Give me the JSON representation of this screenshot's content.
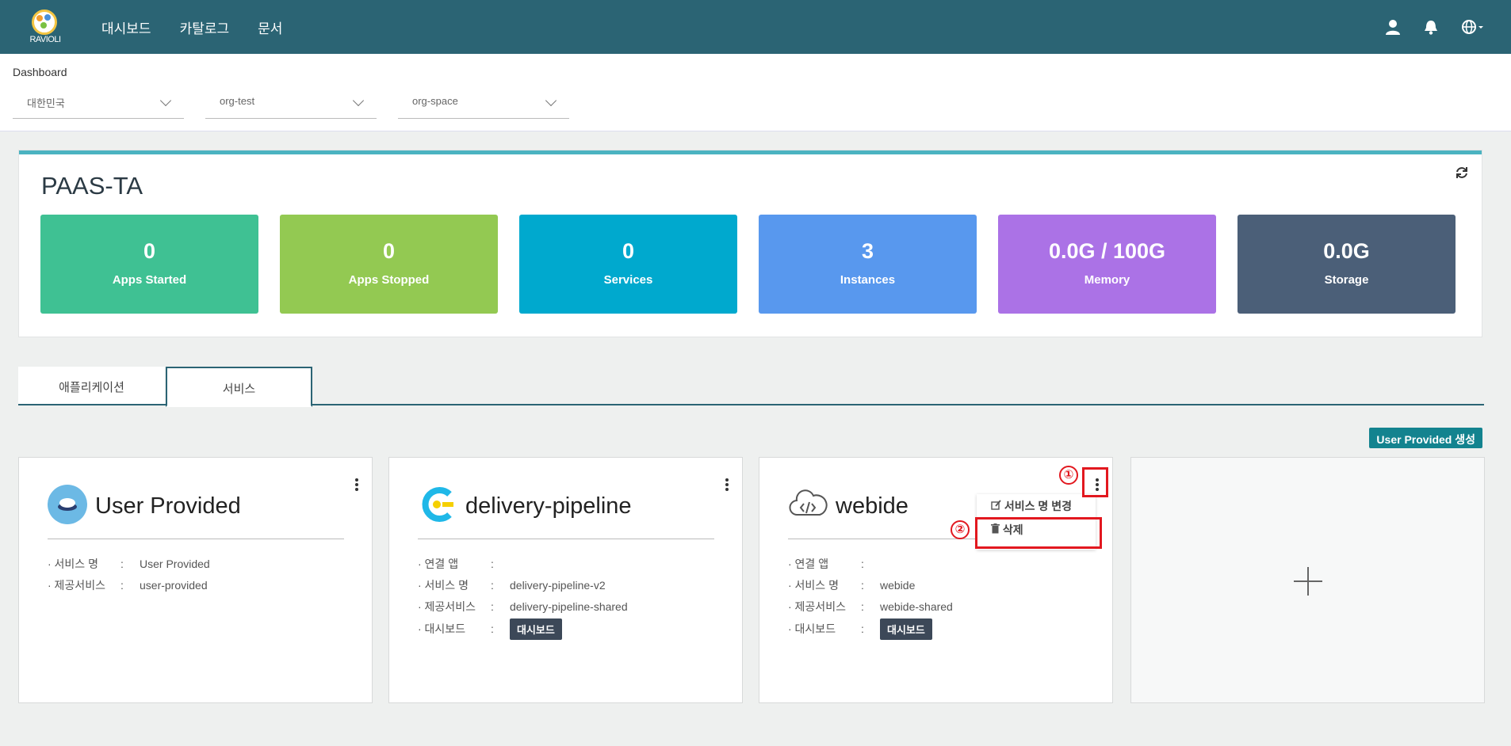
{
  "nav": {
    "logo_text": "RAVIOLI",
    "links": [
      "대시보드",
      "카탈로그",
      "문서"
    ]
  },
  "header": {
    "breadcrumb": "Dashboard",
    "selects": [
      "대한민국",
      "org-test",
      "org-space"
    ]
  },
  "panel": {
    "title": "PAAS-TA",
    "stats": [
      {
        "value": "0",
        "label": "Apps Started",
        "color": "#3fc193"
      },
      {
        "value": "0",
        "label": "Apps Stopped",
        "color": "#93c952"
      },
      {
        "value": "0",
        "label": "Services",
        "color": "#00a9ce"
      },
      {
        "value": "3",
        "label": "Instances",
        "color": "#5898ee"
      },
      {
        "value": "0.0G / 100G",
        "label": "Memory",
        "color": "#ab72e6"
      },
      {
        "value": "0.0G",
        "label": "Storage",
        "color": "#4b5f78"
      }
    ]
  },
  "tabs": [
    "애플리케이션",
    "서비스"
  ],
  "user_provided_button": "User Provided 생성",
  "cards": [
    {
      "name": "User Provided",
      "rows": [
        {
          "key": "· 서비스 명",
          "value": "User Provided"
        },
        {
          "key": "· 제공서비스",
          "value": "user-provided"
        }
      ]
    },
    {
      "name": "delivery-pipeline",
      "rows": [
        {
          "key": "· 연결 앱",
          "value": ""
        },
        {
          "key": "· 서비스 명",
          "value": "delivery-pipeline-v2"
        },
        {
          "key": "· 제공서비스",
          "value": "delivery-pipeline-shared"
        },
        {
          "key": "· 대시보드",
          "value": ""
        }
      ],
      "dashboard_button": "대시보드"
    },
    {
      "name": "webide",
      "rows": [
        {
          "key": "· 연결 앱",
          "value": ""
        },
        {
          "key": "· 서비스 명",
          "value": "webide"
        },
        {
          "key": "· 제공서비스",
          "value": "webide-shared"
        },
        {
          "key": "· 대시보드",
          "value": ""
        }
      ],
      "dashboard_button": "대시보드"
    }
  ],
  "context_menu": {
    "items": [
      "서비스 명 변경",
      "삭제"
    ]
  },
  "markers": [
    "①",
    "②"
  ],
  "colors": {
    "nav_bg": "#2b6474",
    "accent": "#4bb3c1",
    "highlight": "#e2181f"
  }
}
